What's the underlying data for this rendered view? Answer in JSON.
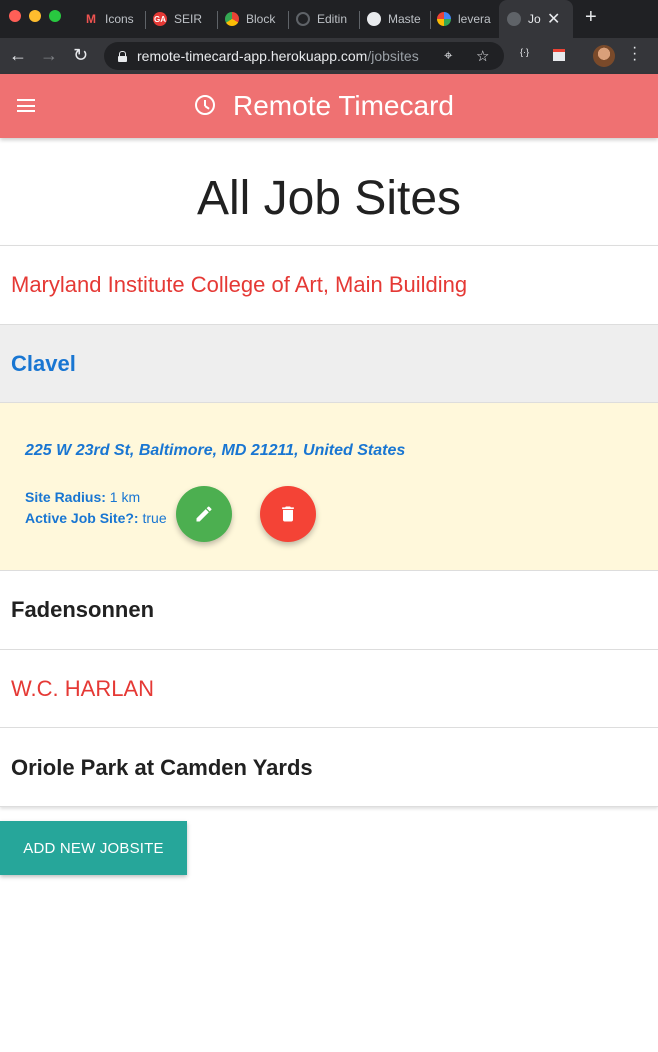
{
  "browser": {
    "tabs": [
      {
        "label": "Icons",
        "favicon": "materialize-icon"
      },
      {
        "label": "SEIR",
        "favicon": "ga-icon"
      },
      {
        "label": "Block",
        "favicon": "chrome-icon"
      },
      {
        "label": "Editin",
        "favicon": "github-icon"
      },
      {
        "label": "Maste",
        "favicon": "github-icon"
      },
      {
        "label": "levera",
        "favicon": "google-icon"
      },
      {
        "label": "Jo",
        "favicon": "globe-icon"
      }
    ],
    "url_host": "remote-timecard-app.herokuapp.com",
    "url_path": "/jobsites"
  },
  "app": {
    "brand": "Remote Timecard",
    "page_title": "All Job Sites",
    "jobsites": [
      {
        "name": "Maryland Institute College of Art, Main Building"
      },
      {
        "name": "Clavel"
      },
      {
        "name": "Fadensonnen"
      },
      {
        "name": "W.C. HARLAN"
      },
      {
        "name": "Oriole Park at Camden Yards"
      }
    ],
    "expanded": {
      "address": "225 W 23rd St, Baltimore, MD 21211, United States",
      "radius_label": "Site Radius:",
      "radius_value": "1 km",
      "active_label": "Active Job Site?:",
      "active_value": "true"
    },
    "add_button": "ADD NEW JOBSITE"
  },
  "colors": {
    "appbar": "#ef7172",
    "link_blue": "#1976d2",
    "red_text": "#e53935",
    "edit_fab": "#4caf50",
    "delete_fab": "#f44336",
    "add_button": "#26a69a",
    "expanded_bg": "#fff8db"
  }
}
